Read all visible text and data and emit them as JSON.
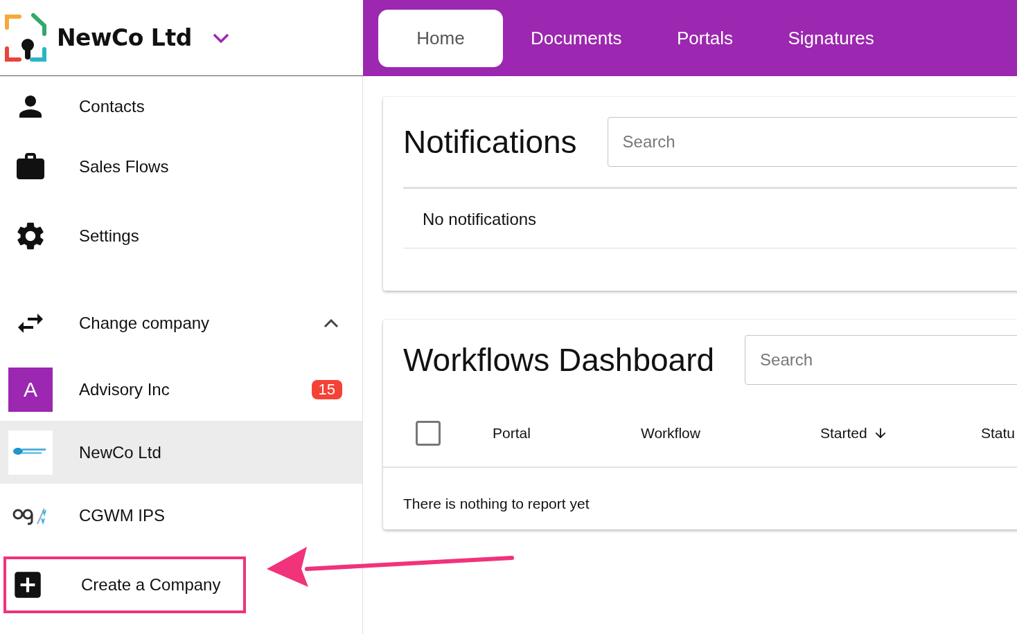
{
  "header": {
    "company_name": "NewCo Ltd",
    "tabs": [
      {
        "label": "Home",
        "selected": true
      },
      {
        "label": "Documents",
        "selected": false
      },
      {
        "label": "Portals",
        "selected": false
      },
      {
        "label": "Signatures",
        "selected": false
      }
    ]
  },
  "sidebar": {
    "nav": [
      {
        "label": "Contacts",
        "kind": "person"
      },
      {
        "label": "Sales Flows",
        "kind": "briefcase"
      },
      {
        "label": "Settings",
        "kind": "gear"
      }
    ],
    "change_company": {
      "label": "Change company",
      "expanded": true
    },
    "companies": [
      {
        "kind": "initial",
        "initial": "A",
        "name": "Advisory Inc",
        "badge": "15",
        "selected": false
      },
      {
        "kind": "logo",
        "name": "NewCo Ltd",
        "selected": true
      },
      {
        "kind": "monogram",
        "name": "CGWM IPS",
        "selected": false
      }
    ],
    "create": {
      "label": "Create a Company",
      "highlighted": true
    }
  },
  "notifications": {
    "title": "Notifications",
    "search": {
      "placeholder": "Search"
    },
    "empty": "No notifications"
  },
  "workflows": {
    "title": "Workflows Dashboard",
    "search": {
      "placeholder": "Search"
    },
    "select_all": {
      "checked": false
    },
    "columns": [
      {
        "label": "Portal",
        "sorted": false
      },
      {
        "label": "Workflow",
        "sorted": false
      },
      {
        "label": "Started",
        "sorted": true
      },
      {
        "label": "Statu",
        "sorted": false
      }
    ],
    "empty": "There is nothing to report yet"
  },
  "annotation": {
    "arrow": true
  }
}
